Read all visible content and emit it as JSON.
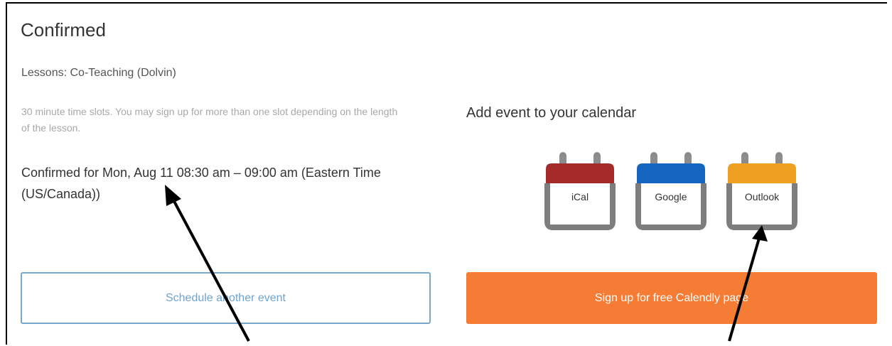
{
  "title": "Confirmed",
  "lesson": "Lessons: Co-Teaching (Dolvin)",
  "description": "30 minute time slots. You may sign up for more than one slot depending on the length of the lesson.",
  "confirmation": "Confirmed for Mon, Aug 11 08:30 am – 09:00 am (Eastern Time (US/Canada))",
  "calendar": {
    "heading": "Add event to your calendar",
    "options": [
      {
        "label": "iCal",
        "color": "#a52a2a",
        "icon": "calendar-icon"
      },
      {
        "label": "Google",
        "color": "#1565c0",
        "icon": "calendar-icon"
      },
      {
        "label": "Outlook",
        "color": "#f0a020",
        "icon": "calendar-icon"
      }
    ]
  },
  "buttons": {
    "schedule": "Schedule another event",
    "signup": "Sign up for free Calendly page"
  },
  "colors": {
    "accent_orange": "#f47c34",
    "accent_blue": "#7aa7cc",
    "calendar_frame": "#7d7d7d"
  }
}
